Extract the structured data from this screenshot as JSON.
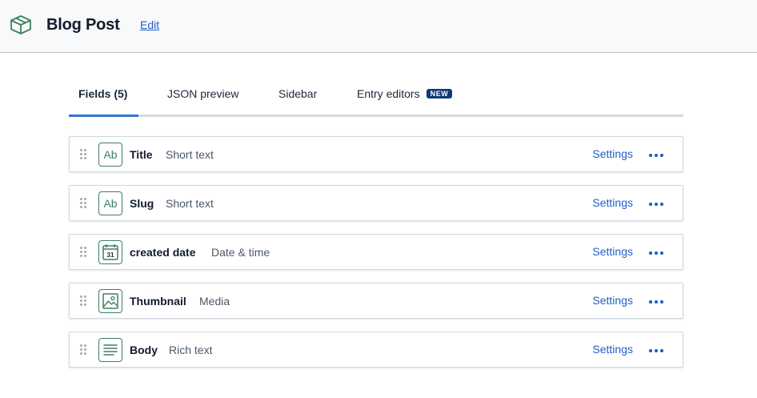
{
  "header": {
    "title": "Blog Post",
    "edit_label": "Edit",
    "logo_icon": "content-type-box-icon"
  },
  "tabs": [
    {
      "label": "Fields (5)",
      "active": true
    },
    {
      "label": "JSON preview",
      "active": false
    },
    {
      "label": "Sidebar",
      "active": false
    },
    {
      "label": "Entry editors",
      "active": false,
      "badge": "NEW"
    }
  ],
  "fields": [
    {
      "name": "Title",
      "type": "Short text",
      "icon": "short-text-icon",
      "settings_label": "Settings"
    },
    {
      "name": "Slug",
      "type": "Short text",
      "icon": "short-text-icon",
      "settings_label": "Settings"
    },
    {
      "name": "created date",
      "type": "Date & time",
      "icon": "calendar-icon",
      "icon_text": "31",
      "settings_label": "Settings"
    },
    {
      "name": "Thumbnail",
      "type": "Media",
      "icon": "media-icon",
      "settings_label": "Settings"
    },
    {
      "name": "Body",
      "type": "Rich text",
      "icon": "rich-text-icon",
      "settings_label": "Settings"
    }
  ],
  "short_text_icon_label": "Ab",
  "colors": {
    "accent": "#2e75d4",
    "link": "#1f5fc9",
    "field_icon": "#3d7f60",
    "badge_bg": "#0c3a75"
  }
}
